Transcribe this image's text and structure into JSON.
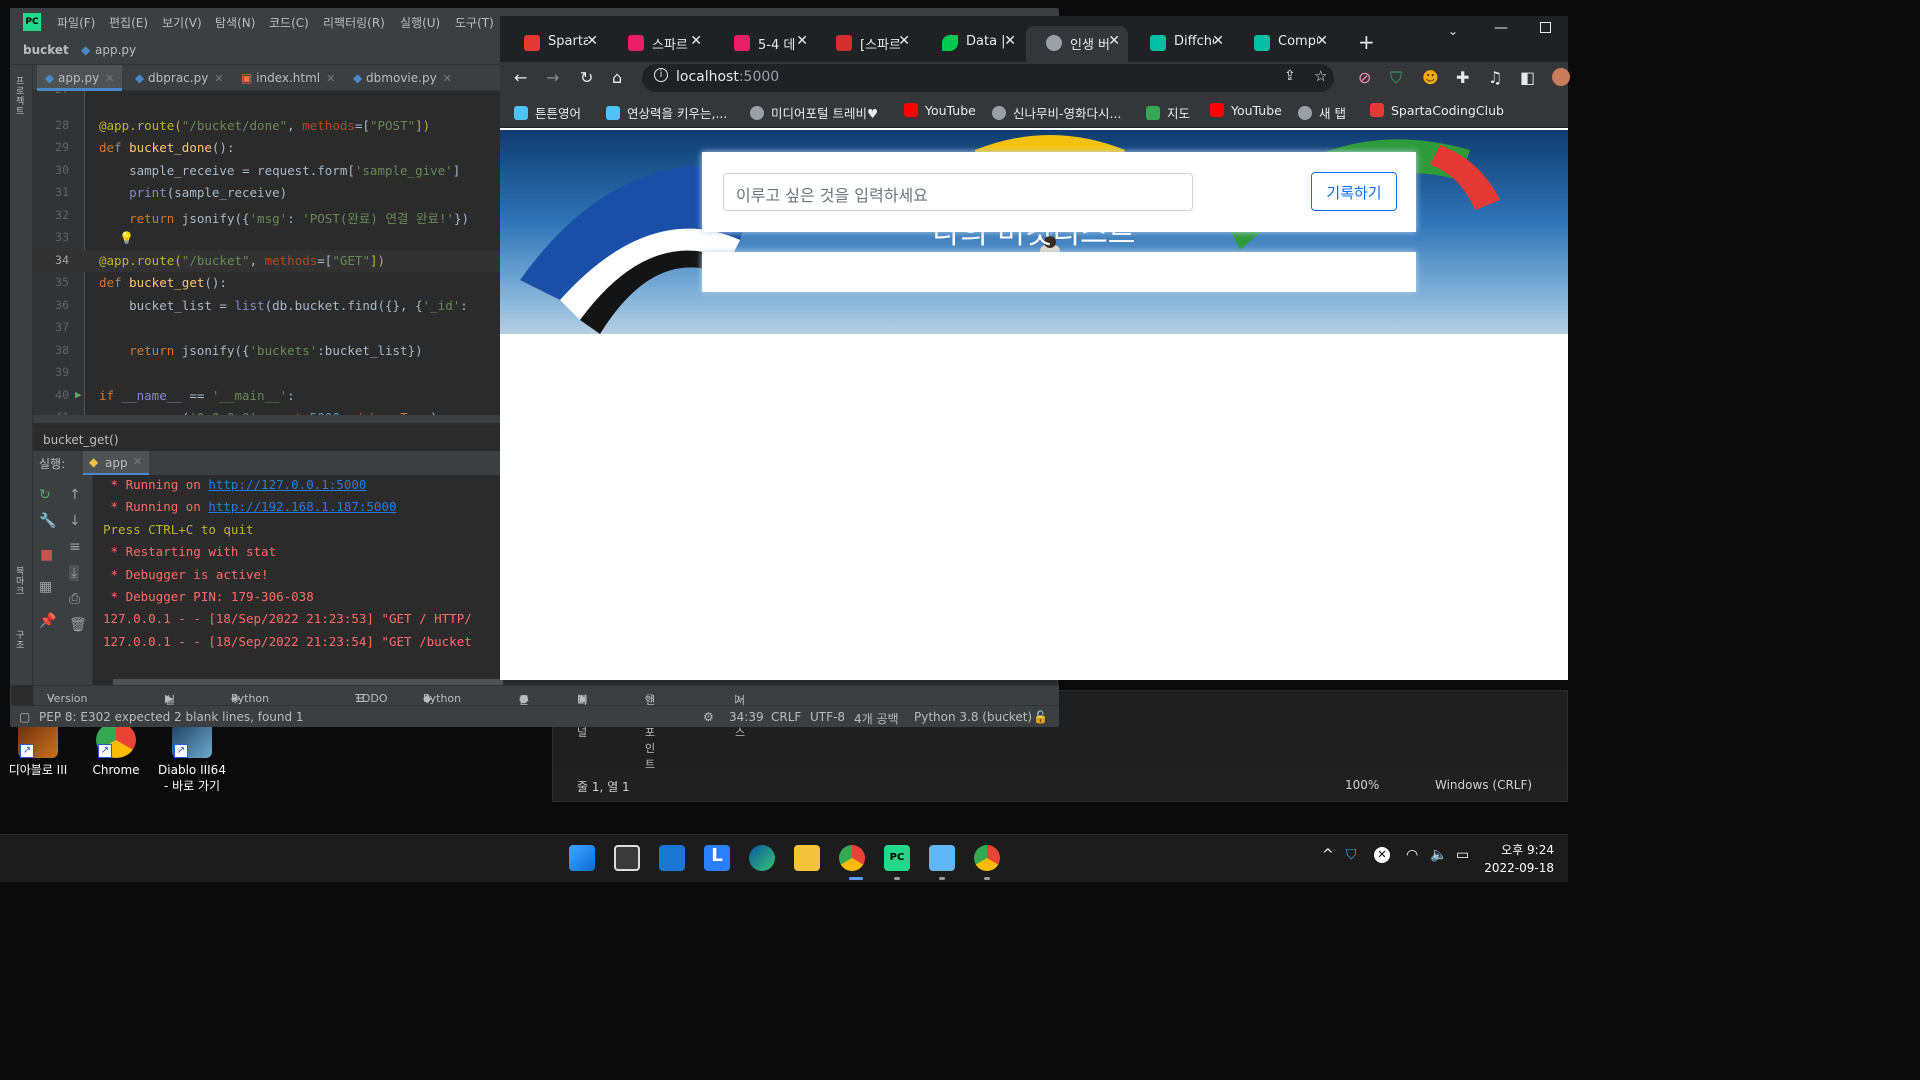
{
  "pycharm": {
    "menu": [
      "파일(F)",
      "편집(E)",
      "보기(V)",
      "탐색(N)",
      "코드(C)",
      "리팩터링(R)",
      "실행(U)",
      "도구(T)"
    ],
    "breadcrumb": {
      "project": "bucket",
      "file": "app.py"
    },
    "left_strip": {
      "project": "프로젝트",
      "bookmarks": "북마크",
      "structure": "구조"
    },
    "tabs": [
      {
        "label": "app.py",
        "active": true
      },
      {
        "label": "dbprac.py",
        "active": false
      },
      {
        "label": "index.html",
        "active": false
      },
      {
        "label": "dbmovie.py",
        "active": false
      }
    ],
    "code": {
      "first_line_number": "27",
      "l28": {
        "n": "28",
        "a": "@app.route(",
        "b": "\"/bucket/done\"",
        "c": ", ",
        "d": "methods",
        "e": "=[",
        "f": "\"POST\"",
        "g": "])"
      },
      "l29": {
        "n": "29",
        "a": "def ",
        "b": "bucket_done",
        "c": "():"
      },
      "l30": {
        "n": "30",
        "a": "    sample_receive = request.form[",
        "b": "'sample_give'",
        "c": "]"
      },
      "l31": {
        "n": "31",
        "a": "    ",
        "b": "print",
        "c": "(sample_receive)"
      },
      "l32": {
        "n": "32",
        "a": "    ",
        "b": "return ",
        "c": "jsonify({",
        "d": "'msg'",
        "e": ": ",
        "f": "'POST(완료) 연결 완료!'",
        "g": "})"
      },
      "l33": {
        "n": "33"
      },
      "l34": {
        "n": "34",
        "a": "@app.route(",
        "b": "\"/bucket\"",
        "c": ", ",
        "d": "methods",
        "e": "=[",
        "f": "\"GET\"",
        "g": "])"
      },
      "l35": {
        "n": "35",
        "a": "def ",
        "b": "bucket_get",
        "c": "():"
      },
      "l36": {
        "n": "36",
        "a": "    bucket_list = ",
        "b": "list",
        "c": "(db.bucket.find({}, {",
        "d": "'_id'",
        "e": ":"
      },
      "l37": {
        "n": "37"
      },
      "l38": {
        "n": "38",
        "a": "    ",
        "b": "return ",
        "c": "jsonify({",
        "d": "'buckets'",
        "e": ":bucket_list})"
      },
      "l39": {
        "n": "39"
      },
      "l40": {
        "n": "40",
        "a": "if ",
        "b": "__name__",
        "c": " == ",
        "d": "'__main__'",
        "e": ":"
      },
      "l41": {
        "n": "41",
        "a": "    app.run(",
        "b": "'0.0.0.0'",
        "c": ", ",
        "d": "port",
        "e": "=",
        "f": "5000",
        "g": ", ",
        "h": "debug",
        "i": "=",
        "j": "True",
        "k": ")"
      }
    },
    "structure_crumb": "bucket_get()",
    "run": {
      "label": "실행:",
      "config": "app"
    },
    "console": {
      "running_local_prefix": " * Running on ",
      "running_local_url": "http://127.0.0.1:5000",
      "running_lan_prefix": " * Running on ",
      "running_lan_url": "http://192.168.1.187:5000",
      "quit": "Press CTRL+C to quit",
      "restart": " * Restarting with stat",
      "debugger": " * Debugger is active!",
      "pin": " * Debugger PIN: 179-306-038",
      "log1": "127.0.0.1 - - [18/Sep/2022 21:23:53] \"GET / HTTP/",
      "log2": "127.0.0.1 - - [18/Sep/2022 21:23:54] \"GET /bucket"
    },
    "bottom_tabs": [
      "Version Control",
      "실행",
      "Python Packages",
      "TODO",
      "Python 콘솔",
      "문제",
      "터미널",
      "엔드포인트",
      "서비스"
    ],
    "status": {
      "message": "PEP 8: E302 expected 2 blank lines, found 1",
      "position": "34:39",
      "line_sep": "CRLF",
      "encoding": "UTF-8",
      "indent": "4개 공백",
      "interpreter": "Python 3.8 (bucket)"
    }
  },
  "chrome": {
    "tabs": [
      {
        "label": "Sparta",
        "color": "#e53935"
      },
      {
        "label": "스파르",
        "color": "#e91e63"
      },
      {
        "label": "5-4 데",
        "color": "#e91e63"
      },
      {
        "label": "[스파르",
        "color": "#d32f2f"
      },
      {
        "label": "Data |",
        "color": "#00c853"
      },
      {
        "label": "인생 버",
        "color": "#9aa0a6",
        "active": true
      },
      {
        "label": "Diffche",
        "color": "#00bfa5"
      },
      {
        "label": "Compu",
        "color": "#00bfa5"
      }
    ],
    "address": {
      "host": "localhost",
      "port": ":5000"
    },
    "bookmarks": [
      {
        "label": "튼튼영어",
        "color": "#4fc3f7"
      },
      {
        "label": "연상력을 키우는,...",
        "color": "#4fc3f7"
      },
      {
        "label": "미디어포털 트레비♥",
        "color": "#9aa0a6"
      },
      {
        "label": "YouTube",
        "color": "#ff0000"
      },
      {
        "label": "신나무비-영화다시...",
        "color": "#9aa0a6"
      },
      {
        "label": "지도",
        "color": "#34a853"
      },
      {
        "label": "YouTube",
        "color": "#ff0000"
      },
      {
        "label": "새 탭",
        "color": "#9aa0a6"
      },
      {
        "label": "SpartaCodingClub",
        "color": "#e53935"
      }
    ]
  },
  "webpage": {
    "title": "나의 버킷리스트",
    "input_placeholder": "이루고 싶은 것을 입력하세요",
    "save_button": "기록하기"
  },
  "notepad": {
    "position": "줄 1, 열 1",
    "zoom": "100%",
    "eol": "Windows (CRLF)"
  },
  "desktop_icons": [
    {
      "label": "디아블로 III"
    },
    {
      "label": "Chrome"
    },
    {
      "label": "Diablo III64 - 바로 가기"
    }
  ],
  "taskbar": {
    "time": "오후 9:24",
    "date": "2022-09-18"
  }
}
